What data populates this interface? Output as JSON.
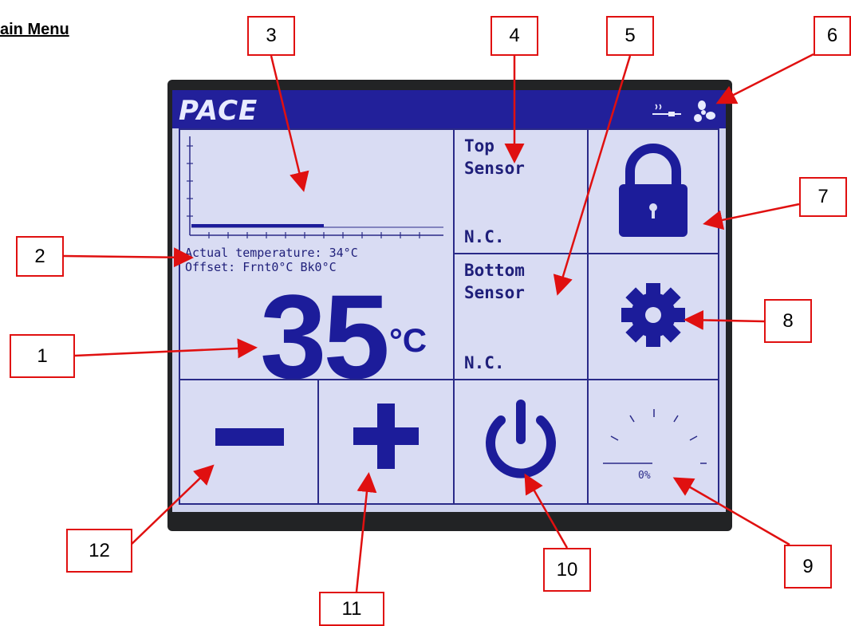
{
  "document": {
    "title": "ain Menu"
  },
  "brand": {
    "logo_text": "PACE"
  },
  "status_icons": [
    "heater-flow-icon",
    "fan-icon"
  ],
  "graph": {
    "icon": "temperature-graph"
  },
  "temperature": {
    "actual_line": "Actual temperature: 34°C",
    "offset_line": "Offset: Frnt0°C Bk0°C",
    "setpoint": "35",
    "unit": "°C"
  },
  "sensors": {
    "top": {
      "title_line1": "Top",
      "title_line2": "Sensor",
      "value": "N.C."
    },
    "bottom": {
      "title_line1": "Bottom",
      "title_line2": "Sensor",
      "value": "N.C."
    }
  },
  "buttons": {
    "lock": "lock-icon",
    "settings": "gear-icon",
    "decrease": "minus-icon",
    "increase": "plus-icon",
    "power": "power-icon",
    "airflow": "airflow-gauge-icon"
  },
  "airflow": {
    "percent": "0%",
    "level": 0
  },
  "colors": {
    "lcd_background": "#d9dcf3",
    "lcd_foreground": "#1c1c9a",
    "callout_red": "#e01010"
  },
  "callouts": [
    "1",
    "2",
    "3",
    "4",
    "5",
    "6",
    "7",
    "8",
    "9",
    "10",
    "11",
    "12"
  ]
}
